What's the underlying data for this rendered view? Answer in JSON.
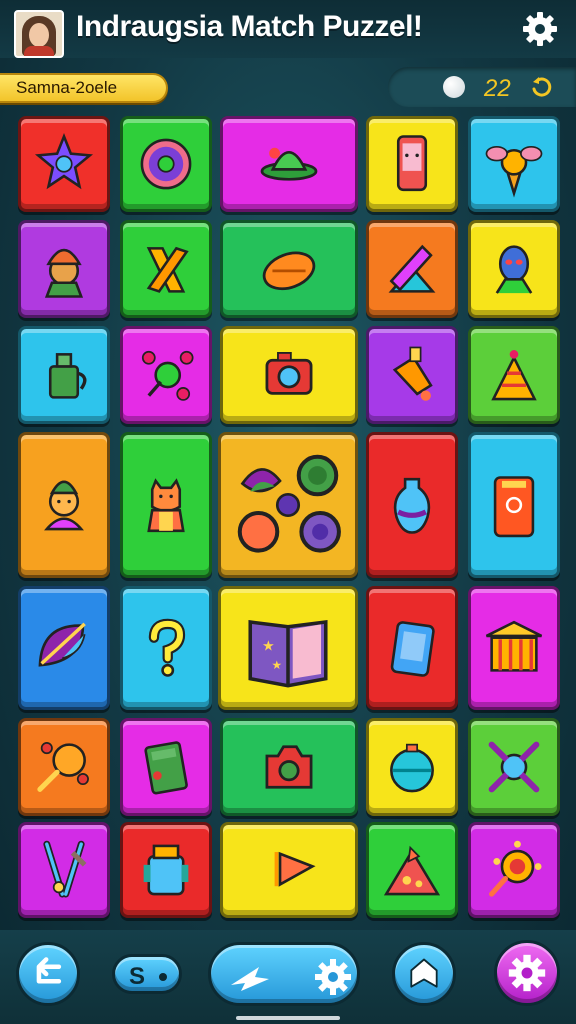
{
  "header": {
    "title": "Indraugsia Match Puzzel!",
    "avatar_icon": "user-avatar",
    "settings_icon": "gear-icon"
  },
  "status_bar": {
    "level_label": "Samna-2oele",
    "score": "22",
    "score_icon": "white-ball",
    "spin_icon": "refresh-icon"
  },
  "board": {
    "tiles": [
      {
        "icon": "star-badge",
        "color": "#f0302a"
      },
      {
        "icon": "donut",
        "color": "#2fcf3a"
      },
      {
        "icon": "green-ufo",
        "color": "#e52ce6"
      },
      {
        "icon": "pink-phone",
        "color": "#f7e41a"
      },
      {
        "icon": "bee-cone",
        "color": "#2ec4ec"
      },
      {
        "icon": "turban-character",
        "color": "#b03ae0"
      },
      {
        "icon": "orange-tool",
        "color": "#2fcf3a"
      },
      {
        "icon": "orange-lemon",
        "color": "#25c15a"
      },
      {
        "icon": "pencil-triangle",
        "color": "#f57a1f"
      },
      {
        "icon": "blue-alien",
        "color": "#f7e41a"
      },
      {
        "icon": "green-kettle",
        "color": "#2ec4ec"
      },
      {
        "icon": "pin-molecule",
        "color": "#e52ce6"
      },
      {
        "icon": "camera",
        "color": "#f7e41a"
      },
      {
        "icon": "paint-bottle",
        "color": "#a63ae8"
      },
      {
        "icon": "cone-pyramid",
        "color": "#5ccf3a"
      },
      {
        "icon": "monkey-character",
        "color": "#f7a11f"
      },
      {
        "icon": "cat-character",
        "color": "#2fcf3a"
      },
      {
        "icon": "flower-cluster",
        "color": "#f3b623"
      },
      {
        "icon": "blue-vase",
        "color": "#ea2a2a"
      },
      {
        "icon": "orange-phone",
        "color": "#2ec4ec"
      },
      {
        "icon": "purple-leaf",
        "color": "#2a8ae8"
      },
      {
        "icon": "question-mark",
        "color": "#2ec4ec"
      },
      {
        "icon": "open-book",
        "color": "#f7e41a"
      },
      {
        "icon": "blue-tablet",
        "color": "#ea2a2a"
      },
      {
        "icon": "temple",
        "color": "#e52ce6"
      },
      {
        "icon": "maraca",
        "color": "#f57a1f"
      },
      {
        "icon": "green-card",
        "color": "#e52ce6"
      },
      {
        "icon": "red-camera",
        "color": "#25c15a"
      },
      {
        "icon": "teal-bomb",
        "color": "#f7e41a"
      },
      {
        "icon": "blue-molecule",
        "color": "#5ccf3a"
      },
      {
        "icon": "scissors-tools",
        "color": "#d22ce6"
      },
      {
        "icon": "blue-jar",
        "color": "#ea2a2a"
      },
      {
        "icon": "play-arrow",
        "color": "#f7e41a"
      },
      {
        "icon": "pizza-slice",
        "color": "#2fcf3a"
      },
      {
        "icon": "sun-lollipop",
        "color": "#d22ce6"
      }
    ]
  },
  "bottom_bar": {
    "back_icon": "back-arrow-icon",
    "counter_label": "S",
    "plane_icon": "plane-icon",
    "settings_icon": "gear-icon",
    "home_icon": "house-icon",
    "power_icon": "gear-icon"
  }
}
